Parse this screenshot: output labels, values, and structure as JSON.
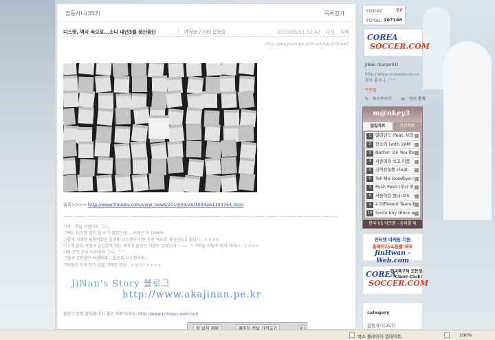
{
  "header": {
    "category_label": "잡동사니(357)",
    "list_label": "목록열기"
  },
  "post": {
    "title": "디스켓, 역사 속으로...소니 내년3월 생산중단",
    "sep": "|",
    "category": "IT정보 / 기타 잡동장",
    "date": "2010/05/11 02:42",
    "edit": "수정",
    "delete": "삭제",
    "trackback_url": "http://akajinan.pe.kr/trackback/30647"
  },
  "source": {
    "label": "출처>>>>",
    "url": "http://www.fnnews.com/view_news/2010/04/26/1004261104754.html"
  },
  "body_lines": [
    "아마...옛날 사람이라 그나....",
    "그때는 디스켓 없이 살 수가 없었는데.....요즘은 다 USB죠",
    "그렇게 거대한 용량이었던 플로피 디스켓이 이젠 추억 속으로 사라진다고 합니다...ㅎㅎㅎㅎ",
    "디스켓 없이 어떻게 살았을까 하는 생각이 들었던 시절도 있었는데 ~~~ 그 기억들 어떻게 정리 하려나...ㅎㅎㅎㅎ",
    "아마 조만 공유 사진이라 그나...^^",
    "그렇게 고마웠던 저장매체 ...플로피 디스켓이여...",
    "기억들은 아마 저기 있을 거예요 안녕...ㅎㅎ??? ㅎㅎㅎㅎ"
  ],
  "signature": {
    "line1": "JiNan's Story 블로그",
    "line2": "http://www.akajinan.pe.kr"
  },
  "footer": {
    "text": "블로그 방문 감사합니다. 좋은 하루 되세요. ",
    "link": "http://www.jinhwan-web.com"
  },
  "stats": {
    "today_label": "TODAY",
    "today_value": "77",
    "total_label": "TOTAL",
    "total_value": "107148"
  },
  "logo": {
    "line1": "COREA",
    "line2": "SOCCER.COM"
  },
  "profile": {
    "name": "JiNan (bunpo01)",
    "link": "http://www.coreasoccer.co",
    "motto": "좋아 좋구나...^^",
    "tag": "프로필",
    "write": "포스트쓰기",
    "admin": "관리 통계"
  },
  "monkey": {
    "logo": "m@nkey3",
    "tab_daily": "일일차트",
    "tab_weekly": "주간차트",
    "songs": [
      {
        "rank": "1",
        "title": "말라던드 (feat. 브라"
      },
      {
        "rank": "2",
        "title": "잔소리 (with 2AM"
      },
      {
        "rank": "3",
        "title": "Nothin' On You (fe"
      },
      {
        "rank": "4",
        "title": "사랑이라 쓰고 아픔"
      },
      {
        "rank": "5",
        "title": "기억상실증 (Feat."
      },
      {
        "rank": "6",
        "title": "Tell Me Goodbye~"
      },
      {
        "rank": "7",
        "title": "Push Push (푸시 푸"
      },
      {
        "rank": "8",
        "title": "사랑하던 썸나-코도"
      },
      {
        "rank": "9",
        "title": "2 Different Tears-E"
      },
      {
        "rank": "10",
        "title": "Smile boy (Rock w"
      }
    ],
    "footer": "한국 VS 아르헨 - 승리를 위"
  },
  "banner": {
    "a": "인터넷 마케팅 지원",
    "b": "홈페이지/쇼핑몰 제작",
    "c": "JinHwan -Web.com"
  },
  "banner2": {
    "line1": "한국축구의 모든것",
    "line2": "Click! Click!"
  },
  "category": {
    "heading": "category",
    "item": "잡동사니(357)"
  },
  "floatbar": {
    "block_btn": "창 보지 해제",
    "info_btn": "페이지 정보 가져오기",
    "close": "×"
  },
  "statusbar": {
    "update": "박스 플레이어 업데이트",
    "zoom": "100%"
  }
}
